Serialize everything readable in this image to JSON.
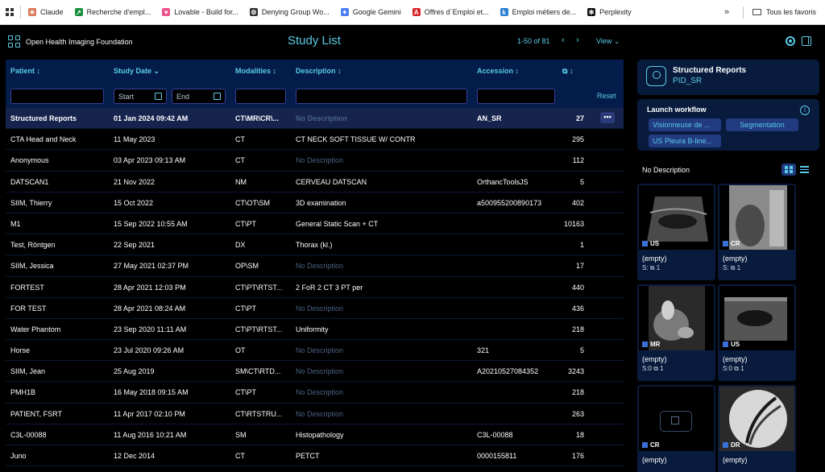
{
  "browser": {
    "bookmarks": [
      {
        "label": "Claude",
        "icon": "claude-icon",
        "color": "#d97757",
        "glyph": "✳"
      },
      {
        "label": "Recherche d'empl...",
        "icon": "job-search-icon",
        "color": "#1a8f3c",
        "glyph": "↗"
      },
      {
        "label": "Lovable - Build for...",
        "icon": "lovable-icon",
        "color": "#f0518a",
        "glyph": "♥"
      },
      {
        "label": "Denying Group Wo...",
        "icon": "openai-icon",
        "color": "#333333",
        "glyph": "⚙"
      },
      {
        "label": "Google Gemini",
        "icon": "gemini-icon",
        "color": "#4a7cf2",
        "glyph": "✦"
      },
      {
        "label": "Offres d´Emploi et...",
        "icon": "offres-icon",
        "color": "#d8232a",
        "glyph": "A"
      },
      {
        "label": "Emploi métiers de...",
        "icon": "kelly-icon",
        "color": "#2a7fd4",
        "glyph": "k"
      },
      {
        "label": "Perplexity",
        "icon": "perplexity-icon",
        "color": "#111111",
        "glyph": "✻"
      }
    ],
    "more": "»",
    "all_bookmarks": "Tous les favoris"
  },
  "header": {
    "org": "Open Health Imaging Foundation",
    "title": "Study List",
    "pagination": "1-50 of 81",
    "prev": "‹",
    "next": "›",
    "view": "View ⌄"
  },
  "table": {
    "columns": {
      "patient": "Patient ↕",
      "study_date": "Study Date ⌄",
      "modalities": "Modalities ↕",
      "description": "Description ↕",
      "accession": "Accession ↕",
      "instances": "↕"
    },
    "filters": {
      "start": "Start",
      "end": "End",
      "reset": "Reset"
    },
    "more_label": "•••",
    "rows": [
      {
        "patient": "Structured Reports",
        "date": "01 Jan 2024 09:42 AM",
        "modalities": "CT\\MR\\CR\\...",
        "description": "No Description",
        "empty_desc": true,
        "accession": "AN_SR",
        "instances": "27",
        "selected": true
      },
      {
        "patient": "CTA Head and Neck",
        "date": "11 May 2023",
        "modalities": "CT",
        "description": "CT NECK SOFT TISSUE W/ CONTR",
        "empty_desc": false,
        "accession": "",
        "instances": "295"
      },
      {
        "patient": "Anonymous",
        "date": "03 Apr 2023 09:13 AM",
        "modalities": "CT",
        "description": "No Description",
        "empty_desc": true,
        "accession": "",
        "instances": "112"
      },
      {
        "patient": "DATSCAN1",
        "date": "21 Nov 2022",
        "modalities": "NM",
        "description": "CERVEAU DATSCAN",
        "empty_desc": false,
        "accession": "OrthancToolsJS",
        "instances": "5"
      },
      {
        "patient": "SIIM, Thierry",
        "date": "15 Oct 2022",
        "modalities": "CT\\OT\\SM",
        "description": "3D examination",
        "empty_desc": false,
        "accession": "a500955200890173",
        "instances": "402"
      },
      {
        "patient": "M1",
        "date": "15 Sep 2022 10:55 AM",
        "modalities": "CT\\PT",
        "description": "General Static Scan + CT",
        "empty_desc": false,
        "accession": "",
        "instances": "10163"
      },
      {
        "patient": "Test, Röntgen",
        "date": "22 Sep 2021",
        "modalities": "DX",
        "description": "Thorax (kl.)",
        "empty_desc": false,
        "accession": "",
        "instances": "1"
      },
      {
        "patient": "SIIM, Jessica",
        "date": "27 May 2021 02:37 PM",
        "modalities": "OP\\SM",
        "description": "No Description",
        "empty_desc": true,
        "accession": "",
        "instances": "17"
      },
      {
        "patient": "FORTEST",
        "date": "28 Apr 2021 12:03 PM",
        "modalities": "CT\\PT\\RTST...",
        "description": "2 FoR 2 CT 3 PT per",
        "empty_desc": false,
        "accession": "",
        "instances": "440"
      },
      {
        "patient": "FOR TEST",
        "date": "28 Apr 2021 08:24 AM",
        "modalities": "CT\\PT",
        "description": "No Description",
        "empty_desc": true,
        "accession": "",
        "instances": "436"
      },
      {
        "patient": "Water Phantom",
        "date": "23 Sep 2020 11:11 AM",
        "modalities": "CT\\PT\\RTST...",
        "description": "Uniformity",
        "empty_desc": false,
        "accession": "",
        "instances": "218"
      },
      {
        "patient": "Horse",
        "date": "23 Jul 2020 09:26 AM",
        "modalities": "OT",
        "description": "No Description",
        "empty_desc": true,
        "accession": "321",
        "instances": "5"
      },
      {
        "patient": "SIIM, Jean",
        "date": "25 Aug 2019",
        "modalities": "SM\\CT\\RTD...",
        "description": "No Description",
        "empty_desc": true,
        "accession": "A20210527084352",
        "instances": "3243"
      },
      {
        "patient": "PMH1B",
        "date": "16 May 2018 09:15 AM",
        "modalities": "CT\\PT",
        "description": "No Description",
        "empty_desc": true,
        "accession": "",
        "instances": "218"
      },
      {
        "patient": "PATIENT, FSRT",
        "date": "11 Apr 2017 02:10 PM",
        "modalities": "CT\\RTSTRU...",
        "description": "No Description",
        "empty_desc": true,
        "accession": "",
        "instances": "263"
      },
      {
        "patient": "C3L-00088",
        "date": "11 Aug 2016 10:21 AM",
        "modalities": "SM",
        "description": "Histopathology",
        "empty_desc": false,
        "accession": "C3L-00088",
        "instances": "18"
      },
      {
        "patient": "Juno",
        "date": "12 Dec 2014",
        "modalities": "CT",
        "description": "PETCT",
        "empty_desc": false,
        "accession": "0000155811",
        "instances": "176"
      }
    ]
  },
  "panel": {
    "study_title": "Structured Reports",
    "study_id": "PID_SR",
    "workflow_title": "Launch workflow",
    "info": "i",
    "workflows": [
      "Visionneuse de ...",
      "Segmentation",
      "US Pleura B-line..."
    ],
    "description": "No Description",
    "series": [
      {
        "modality": "US",
        "label": "(empty)",
        "meta": "S:  ⧉ 1",
        "image": "us"
      },
      {
        "modality": "CR",
        "label": "(empty)",
        "meta": "S:  ⧉ 1",
        "image": "cr"
      },
      {
        "modality": "MR",
        "label": "(empty)",
        "meta": "S:0  ⧉ 1",
        "image": "mr"
      },
      {
        "modality": "US",
        "label": "(empty)",
        "meta": "S:0  ⧉ 1",
        "image": "us2"
      },
      {
        "modality": "CR",
        "label": "(empty)",
        "meta": "",
        "image": "none"
      },
      {
        "modality": "DR",
        "label": "(empty)",
        "meta": "",
        "image": "dr"
      }
    ]
  },
  "colors": {
    "accent": "#5acce6",
    "header_bg": "#041c4a",
    "selected_row": "#16234c",
    "panel_bg": "#091b3d"
  }
}
